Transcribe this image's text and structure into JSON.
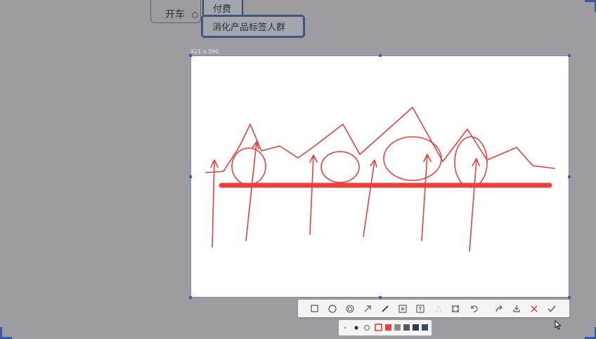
{
  "mindmap": {
    "node_kaiche": "开车",
    "node_fufei": "付费",
    "node_xiaohua": "消化产品标签人群"
  },
  "capture": {
    "size_label": "921 x 590"
  },
  "colors": {
    "pen_red": "#e8403a",
    "selection_blue": "#3f63b2",
    "overlay_gray": "#9c9ca1"
  },
  "toolbar": {
    "tools": [
      "rectangle-icon",
      "ellipse-icon",
      "mosaic-icon",
      "arrow-icon",
      "pen-icon",
      "highlight-icon",
      "text-icon",
      "eraser-icon",
      "pin-icon",
      "undo-icon",
      "share-icon",
      "save-icon",
      "cancel-icon",
      "confirm-icon"
    ]
  },
  "style_options": {
    "sizes": [
      "small",
      "medium",
      "large"
    ],
    "colors": [
      "#e8403a",
      "#e8403a",
      "#8a8a8a",
      "#5a5a5a",
      "#2e3a55",
      "#3a4a68"
    ]
  }
}
